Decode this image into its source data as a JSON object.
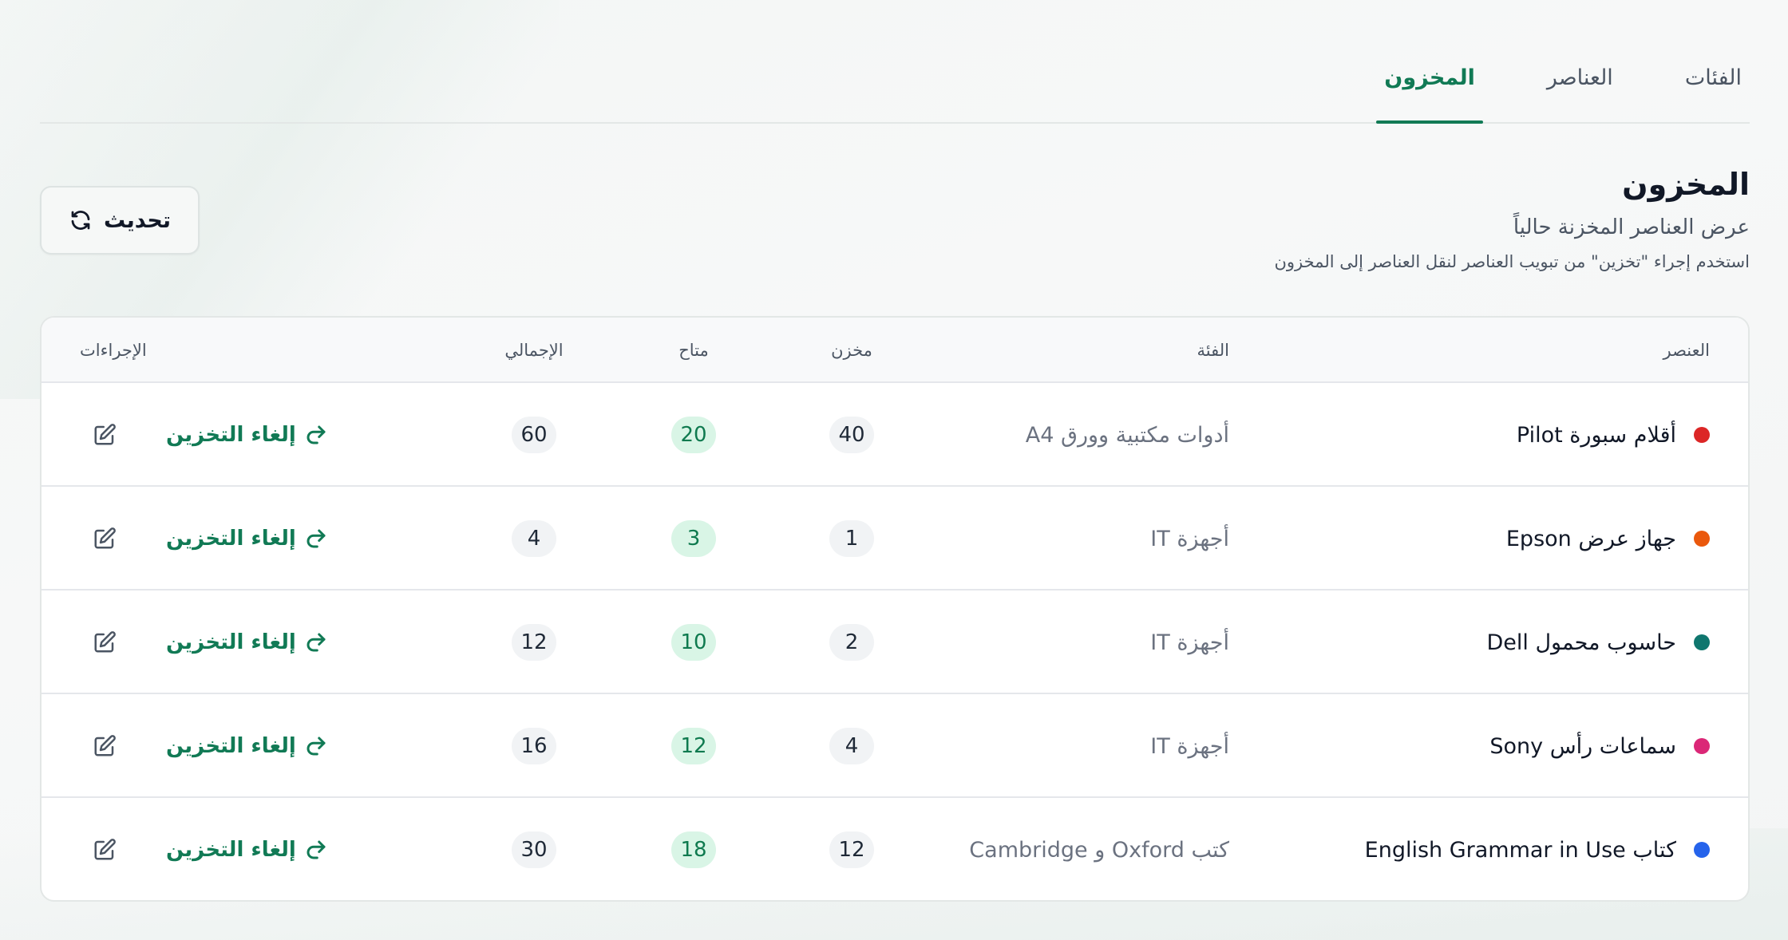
{
  "tabs": [
    {
      "label": "الفئات",
      "active": false
    },
    {
      "label": "العناصر",
      "active": false
    },
    {
      "label": "المخزون",
      "active": true
    }
  ],
  "header": {
    "title": "المخزون",
    "subtitle": "عرض العناصر المخزنة حالياً",
    "hint": "استخدم إجراء \"تخزين\" من تبويب العناصر لنقل العناصر إلى المخزون"
  },
  "refresh_button": {
    "label": "تحديث",
    "icon": "refresh-icon"
  },
  "table": {
    "headers": {
      "item": "العنصر",
      "category": "الفئة",
      "stored": "مخزن",
      "available": "متاح",
      "total": "الإجمالي",
      "actions": "الإجراءات"
    },
    "unstore_label": "إلغاء التخزين",
    "rows": [
      {
        "dot_color": "#dc2626",
        "name": "أقلام سبورة Pilot",
        "category": "أدوات مكتبية وورق A4",
        "stored": "40",
        "available": "20",
        "total": "60"
      },
      {
        "dot_color": "#ea580c",
        "name": "جهاز عرض Epson",
        "category": "أجهزة IT",
        "stored": "1",
        "available": "3",
        "total": "4"
      },
      {
        "dot_color": "#0f766e",
        "name": "حاسوب محمول Dell",
        "category": "أجهزة IT",
        "stored": "2",
        "available": "10",
        "total": "12"
      },
      {
        "dot_color": "#db2777",
        "name": "سماعات رأس Sony",
        "category": "أجهزة IT",
        "stored": "4",
        "available": "12",
        "total": "16"
      },
      {
        "dot_color": "#2563eb",
        "name": "كتاب English Grammar in Use",
        "category": "كتب Oxford و Cambridge",
        "stored": "12",
        "available": "18",
        "total": "30"
      }
    ]
  },
  "colors": {
    "accent": "#117a55",
    "available_bg": "#d9f5e6"
  }
}
